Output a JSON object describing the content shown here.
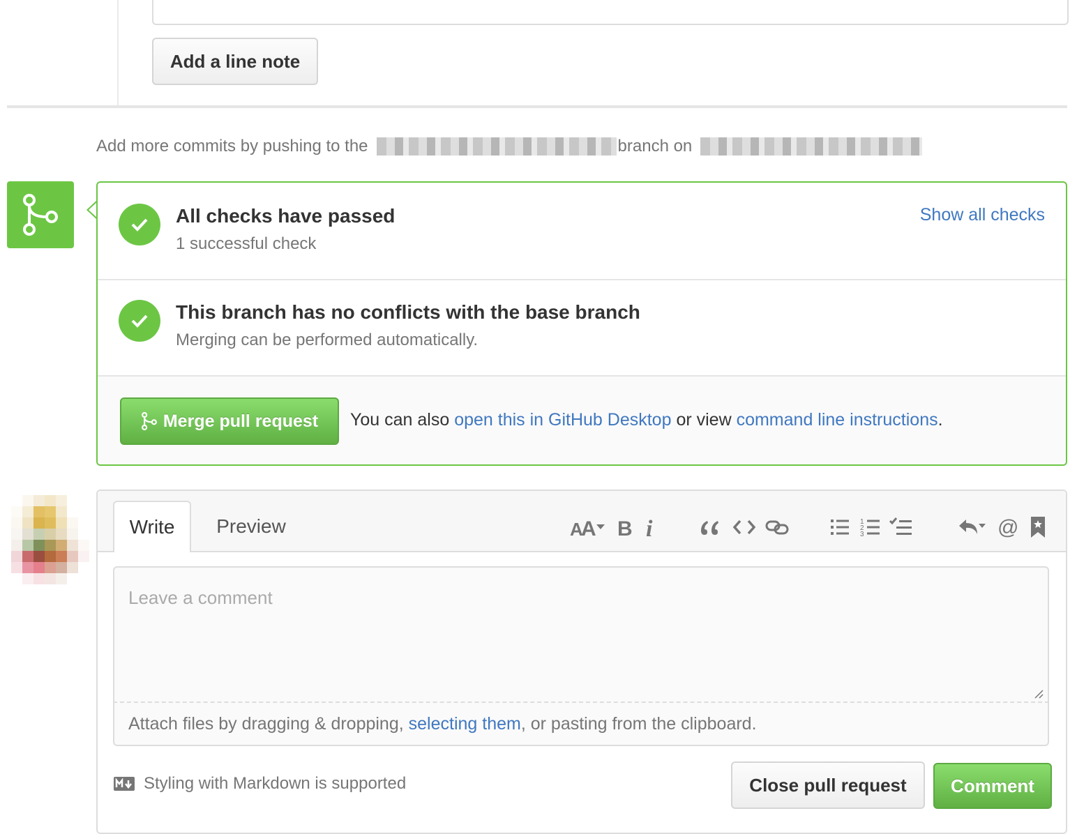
{
  "line_note": {
    "button_label": "Add a line note"
  },
  "push_hint": {
    "prefix": "Add more commits by pushing to the",
    "middle": "branch on"
  },
  "checks": {
    "title": "All checks have passed",
    "subtitle": "1 successful check",
    "show_all": "Show all checks"
  },
  "conflicts": {
    "title": "This branch has no conflicts with the base branch",
    "subtitle": "Merging can be performed automatically."
  },
  "merge": {
    "button_label": "Merge pull request",
    "also_prefix": "You can also",
    "desktop_link": "open this in GitHub Desktop",
    "or_view": "or view",
    "cli_link": "command line instructions",
    "period": "."
  },
  "comment": {
    "tabs": {
      "write": "Write",
      "preview": "Preview"
    },
    "placeholder": "Leave a comment",
    "attach_prefix": "Attach files by dragging & dropping,",
    "attach_link": "selecting them",
    "attach_suffix": ", or pasting from the clipboard.",
    "markdown_note": "Styling with Markdown is supported",
    "close_button": "Close pull request",
    "comment_button": "Comment"
  },
  "colors": {
    "success": "#6cc644",
    "link": "#4078c0",
    "muted": "#767676"
  },
  "toolbar_icons": [
    "text-size-icon",
    "bold-icon",
    "italic-icon",
    "quote-icon",
    "code-icon",
    "link-icon",
    "unordered-list-icon",
    "ordered-list-icon",
    "task-list-icon",
    "reply-icon",
    "mention-icon",
    "bookmark-icon"
  ]
}
